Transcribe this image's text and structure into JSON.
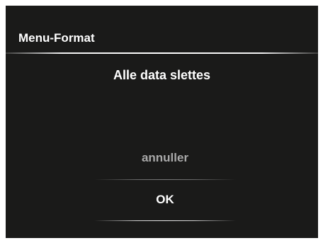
{
  "header": {
    "title": "Menu-Format"
  },
  "dialog": {
    "message": "Alle data slettes",
    "options": [
      {
        "label": "annuller",
        "selected": false
      },
      {
        "label": "OK",
        "selected": true
      }
    ]
  },
  "colors": {
    "background": "#1a1a19",
    "text": "#ffffff",
    "inactive_option": "#a9a9a9"
  }
}
